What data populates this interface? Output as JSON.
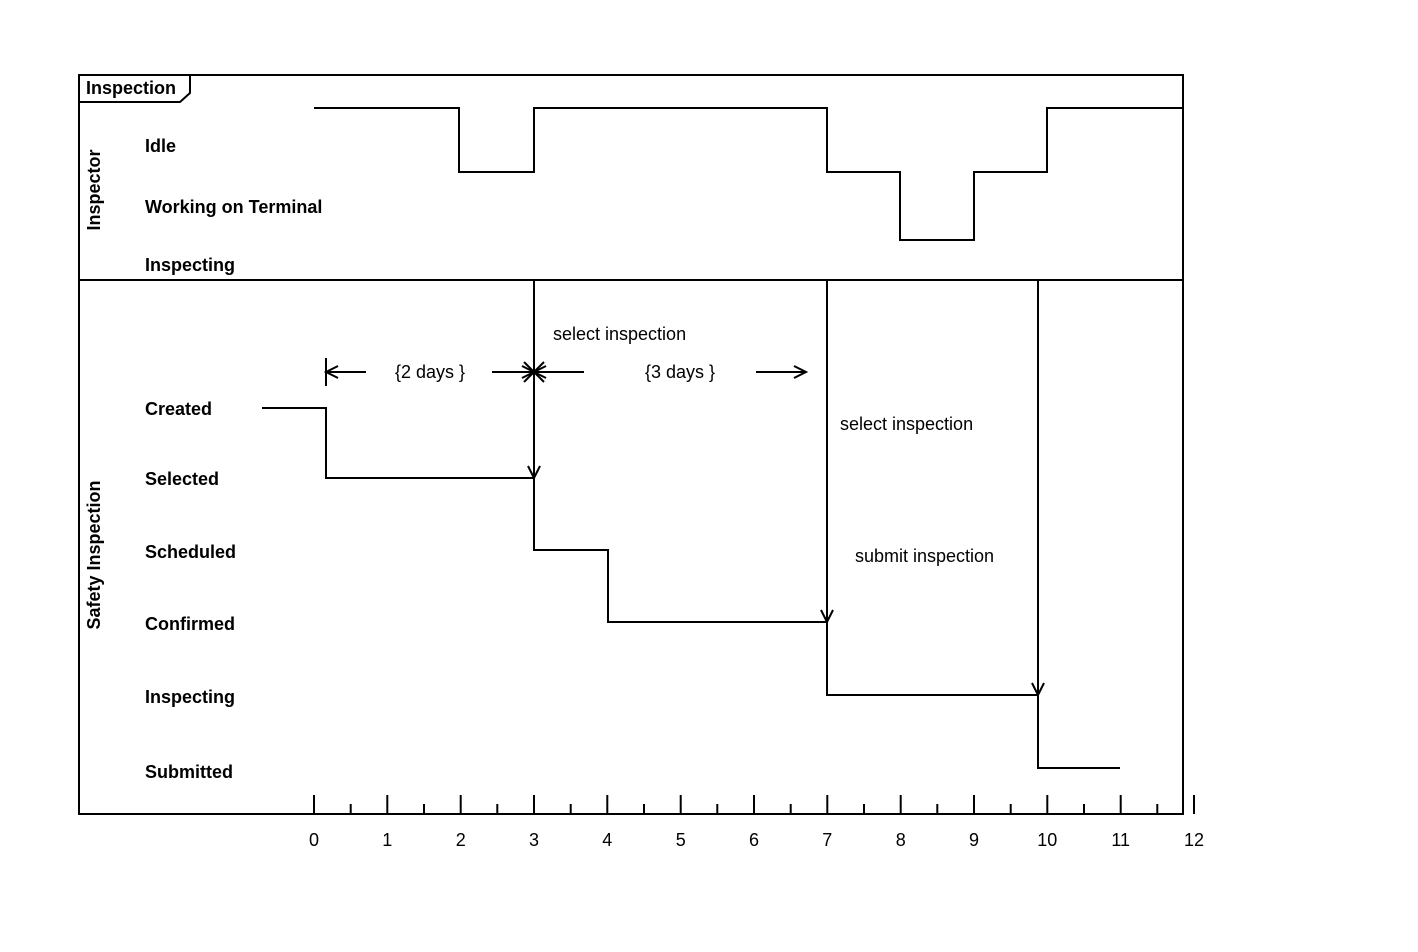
{
  "diagram": {
    "title": "Inspection",
    "swimlanes": [
      {
        "name": "Inspector",
        "states": [
          "Idle",
          "Working on Terminal",
          "Inspecting"
        ]
      },
      {
        "name": "Safety Inspection",
        "states": [
          "Created",
          "Selected",
          "Scheduled",
          "Confirmed",
          "Inspecting",
          "Submitted"
        ]
      }
    ],
    "xaxis": {
      "ticks": [
        "0",
        "1",
        "2",
        "3",
        "4",
        "5",
        "6",
        "7",
        "8",
        "9",
        "10",
        "11",
        "12"
      ]
    },
    "annotations": {
      "select_inspection_top": "select inspection",
      "select_inspection_right": "select inspection",
      "submit_inspection": "submit inspection",
      "two_days": "{2 days }",
      "three_days": "{3 days }"
    }
  },
  "chart_data": {
    "type": "timing",
    "xunit": "days",
    "xrange": [
      0,
      12
    ],
    "series": [
      {
        "name": "Inspector",
        "states": [
          "Idle",
          "Working on Terminal",
          "Inspecting"
        ],
        "segments": [
          {
            "state": "Idle",
            "from": 1,
            "to": 2
          },
          {
            "state": "Working on Terminal",
            "from": 2,
            "to": 3
          },
          {
            "state": "Idle",
            "from": 3,
            "to": 7
          },
          {
            "state": "Working on Terminal",
            "from": 7,
            "to": 8
          },
          {
            "state": "Inspecting",
            "from": 8,
            "to": 9
          },
          {
            "state": "Working on Terminal",
            "from": 9,
            "to": 10
          },
          {
            "state": "Idle",
            "from": 10,
            "to": 12
          }
        ]
      },
      {
        "name": "Safety Inspection",
        "states": [
          "Created",
          "Selected",
          "Scheduled",
          "Confirmed",
          "Inspecting",
          "Submitted"
        ],
        "segments": [
          {
            "state": "Created",
            "from": 0,
            "to": 1
          },
          {
            "state": "Selected",
            "from": 1,
            "to": 3
          },
          {
            "state": "Scheduled",
            "from": 3,
            "to": 4
          },
          {
            "state": "Confirmed",
            "from": 4,
            "to": 7
          },
          {
            "state": "Inspecting",
            "from": 7,
            "to": 10
          },
          {
            "state": "Submitted",
            "from": 10,
            "to": 11
          }
        ]
      }
    ],
    "durations": [
      {
        "from": 1,
        "to": 3,
        "label": "{2 days }"
      },
      {
        "from": 3,
        "to": 7,
        "label": "{3 days }"
      }
    ],
    "messages": [
      {
        "at": 3,
        "text": "select inspection",
        "from": "Inspector",
        "to": "Safety Inspection"
      },
      {
        "at": 7,
        "text": "select inspection",
        "from": "Inspector",
        "to": "Safety Inspection"
      },
      {
        "at": 10,
        "text": "submit inspection",
        "from": "Inspector",
        "to": "Safety Inspection"
      }
    ]
  }
}
